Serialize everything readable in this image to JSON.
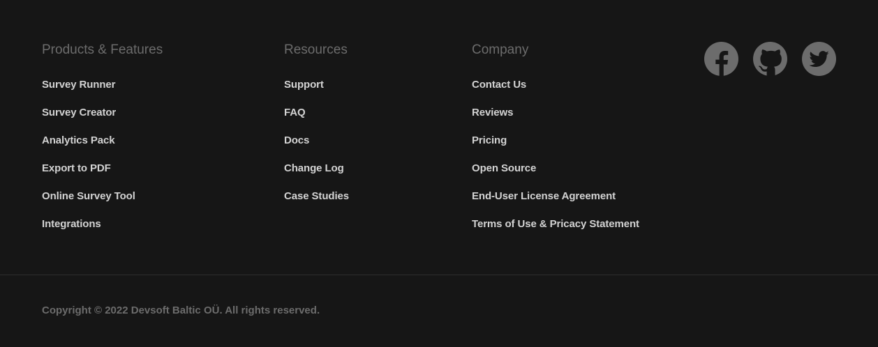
{
  "footer": {
    "columns": {
      "products": {
        "heading": "Products & Features",
        "links": [
          "Survey Runner",
          "Survey Creator",
          "Analytics Pack",
          "Export to PDF",
          "Online Survey Tool",
          "Integrations"
        ]
      },
      "resources": {
        "heading": "Resources",
        "links": [
          "Support",
          "FAQ",
          "Docs",
          "Change Log",
          "Case Studies"
        ]
      },
      "company": {
        "heading": "Company",
        "links": [
          "Contact Us",
          "Reviews",
          "Pricing",
          "Open Source",
          "End-User License Agreement",
          "Terms of Use & Pricacy Statement"
        ]
      }
    },
    "social": [
      {
        "icon": "facebook-icon"
      },
      {
        "icon": "github-icon"
      },
      {
        "icon": "twitter-icon"
      }
    ],
    "copyright": "Copyright © 2022 Devsoft Baltic OÜ. All rights reserved.",
    "colors": {
      "background": "#161616",
      "heading": "#6c6c6c",
      "link": "#d3d3d3",
      "icon": "#6c6c6c",
      "divider": "#2d2d2d"
    }
  }
}
